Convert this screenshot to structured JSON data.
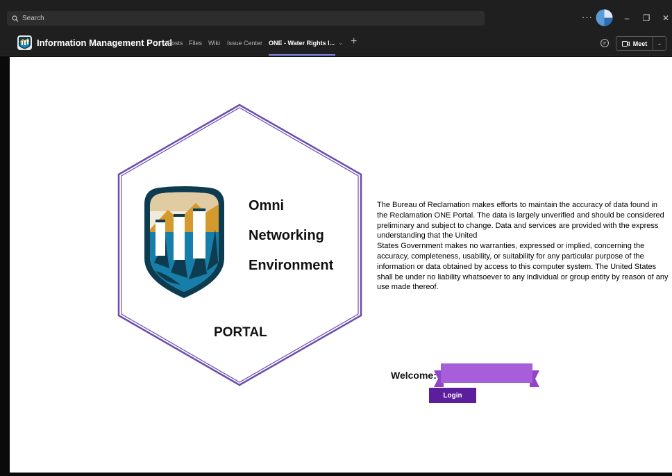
{
  "titlebar": {
    "search_placeholder": "Search",
    "more_label": "···"
  },
  "window_controls": {
    "minimize": "–",
    "restore": "❐",
    "close": "✕"
  },
  "tabbar": {
    "team_name": "Information Management Portal",
    "tabs": [
      {
        "label": "Posts"
      },
      {
        "label": "Files"
      },
      {
        "label": "Wiki"
      },
      {
        "label": "Issue Center"
      },
      {
        "label": "ONE - Water Rights I..."
      }
    ],
    "active_tab": "ONE - Water Rights I...",
    "add_tab_label": "+",
    "meet_label": "Meet",
    "accent_color": "#7f85f5"
  },
  "content": {
    "logo_lines": [
      "Omni",
      "Networking",
      "Environment"
    ],
    "portal_label": "PORTAL",
    "disclaimer_lines": [
      "The Bureau of Reclamation makes efforts to maintain the accuracy of data found in the Reclamation ONE Portal. The data is largely unverified and should be considered preliminary and subject to change. Data and services are provided with the express understanding that the United",
      "States Government makes no warranties, expressed or implied, concerning the accuracy, completeness, usability, or suitability for any particular purpose of the information or data obtained by access to this computer system. The United States shall be under no liability whatsoever to any individual or group entity by reason of any use made thereof."
    ],
    "welcome_label": "Welcome:",
    "login_label": "Login",
    "hex_color": "#6a4bb0",
    "ribbon_color": "#a65fd8",
    "login_color": "#5b1f9e"
  }
}
